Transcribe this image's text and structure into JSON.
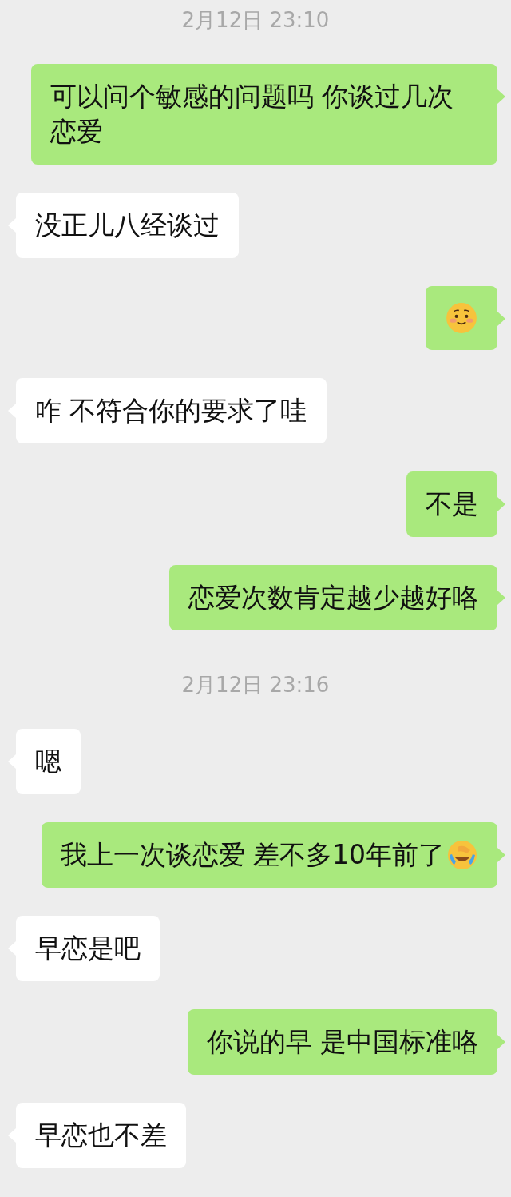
{
  "items": [
    {
      "kind": "timestamp",
      "text": "2月12日 23:10"
    },
    {
      "kind": "text",
      "outgoing": true,
      "text": "可以问个敏感的问题吗 你谈过几次恋爱",
      "has_emoji": false
    },
    {
      "kind": "text",
      "outgoing": false,
      "text": "没正儿八经谈过",
      "has_emoji": false
    },
    {
      "kind": "emoji",
      "outgoing": true
    },
    {
      "kind": "text",
      "outgoing": false,
      "text": "咋 不符合你的要求了哇",
      "has_emoji": false
    },
    {
      "kind": "text",
      "outgoing": true,
      "text": "不是",
      "has_emoji": false
    },
    {
      "kind": "text",
      "outgoing": true,
      "text": "恋爱次数肯定越少越好咯",
      "has_emoji": false
    },
    {
      "kind": "timestamp",
      "text": "2月12日 23:16"
    },
    {
      "kind": "text",
      "outgoing": false,
      "text": "嗯",
      "has_emoji": false
    },
    {
      "kind": "text",
      "outgoing": true,
      "text": "我上一次谈恋爱 差不多10年前了",
      "has_emoji": true
    },
    {
      "kind": "text",
      "outgoing": false,
      "text": "早恋是吧",
      "has_emoji": false
    },
    {
      "kind": "text",
      "outgoing": true,
      "text": "你说的早 是中国标准咯",
      "has_emoji": false
    },
    {
      "kind": "text",
      "outgoing": false,
      "text": "早恋也不差",
      "has_emoji": false
    }
  ]
}
